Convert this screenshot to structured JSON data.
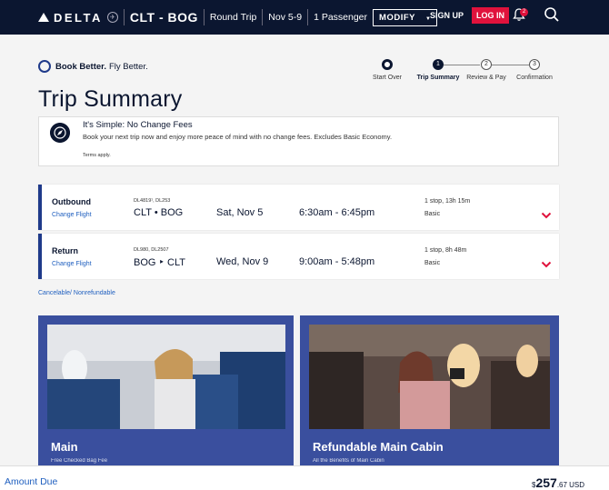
{
  "header": {
    "logo_text": "DELTA",
    "route": "CLT - BOG",
    "trip_type": "Round Trip",
    "dates": "Nov 5-9",
    "passengers": "1 Passenger",
    "modify_label": "MODIFY",
    "signup_label": "SIGN UP",
    "login_label": "LOG IN",
    "notification_count": "2"
  },
  "book_better": {
    "bold": "Book Better.",
    "rest": "Fly Better."
  },
  "stepper": [
    {
      "num": "",
      "label": "Start Over"
    },
    {
      "num": "1",
      "label": "Trip Summary"
    },
    {
      "num": "2",
      "label": "Review & Pay"
    },
    {
      "num": "3",
      "label": "Confirmation"
    }
  ],
  "page_title": "Trip Summary",
  "notice": {
    "heading": "It's Simple: No Change Fees",
    "body": "Book your next trip now and enjoy more peace of mind with no change fees. Excludes Basic Economy.",
    "terms": "Terms apply."
  },
  "flights": [
    {
      "type": "Outbound",
      "change": "Change Flight",
      "flight_nums": "DL4819¹, DL253",
      "route": "CLT • BOG",
      "date": "Sat, Nov 5",
      "time": "6:30am - 6:45pm",
      "stops": "1 stop, 13h 15m",
      "fare": "Basic"
    },
    {
      "type": "Return",
      "change": "Change Flight",
      "flight_nums": "DL980, DL2507",
      "route": "BOG ‣ CLT",
      "date": "Wed, Nov 9",
      "time": "9:00am - 5:48pm",
      "stops": "1 stop, 8h 48m",
      "fare": "Basic"
    }
  ],
  "cancel_policy": "Cancelable/ Nonrefundable",
  "cabins": [
    {
      "name": "Main",
      "sub": "Free Checked Bag Fee"
    },
    {
      "name": "Refundable Main Cabin",
      "sub": "All the Benefits of Main Cabin"
    }
  ],
  "amount": {
    "label": "Amount Due",
    "currency_symbol": "$",
    "whole": "257",
    "cents": ".67 USD"
  },
  "colors": {
    "header_bg": "#0b1630",
    "accent_red": "#e0123c",
    "link_blue": "#1f5fbf",
    "card_blue": "#3a4f9e"
  }
}
